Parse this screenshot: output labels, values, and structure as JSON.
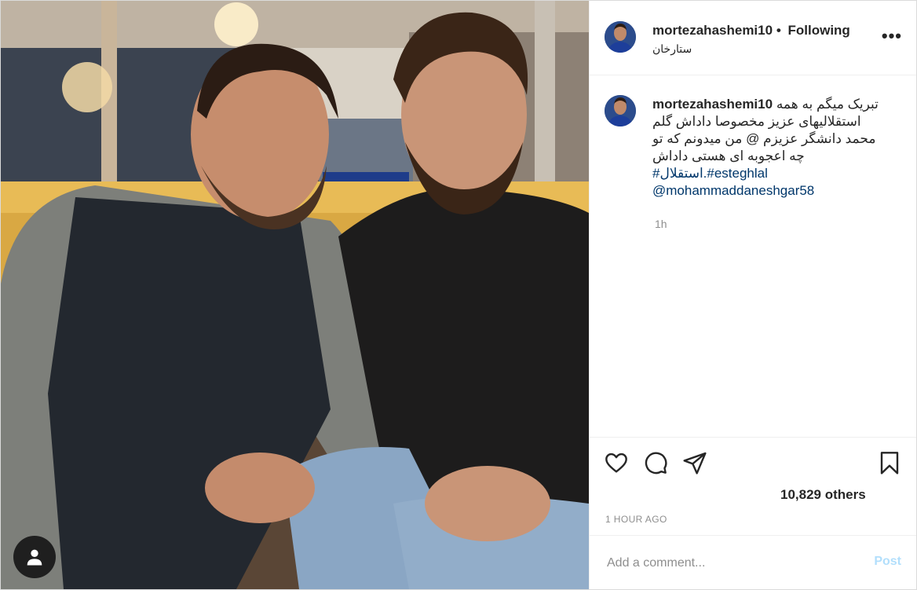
{
  "header": {
    "username": "mortezahashemi10",
    "separator": "•",
    "follow_label": "Following",
    "location": "ستارخان",
    "more_label": "•••"
  },
  "caption": {
    "username": "mortezahashemi10",
    "line1": "تبریک میگم به همه",
    "line2": "استقلالیهای عزیز مخصوصا داداش گلم",
    "line3": "محمد دانشگر عزیزم @ من میدونم که تو",
    "line4": "چه اعجوبه ای هستی داداش",
    "hashtags": "#استقلال.#esteghlal",
    "mention": "@mohammaddaneshgar58",
    "time": "1h"
  },
  "actions": {
    "likes": "10,829 others",
    "post_time": "1 HOUR AGO"
  },
  "comment_box": {
    "placeholder": "Add a comment...",
    "post_label": "Post"
  },
  "icons": [
    "heart-icon",
    "comment-icon",
    "share-icon",
    "bookmark-icon",
    "tag-people-icon",
    "more-icon"
  ],
  "colors": {
    "link": "#00376b",
    "muted": "#8e8e8e",
    "post_disabled": "#b2dffc",
    "avatar_jersey": "#1d3e78"
  }
}
